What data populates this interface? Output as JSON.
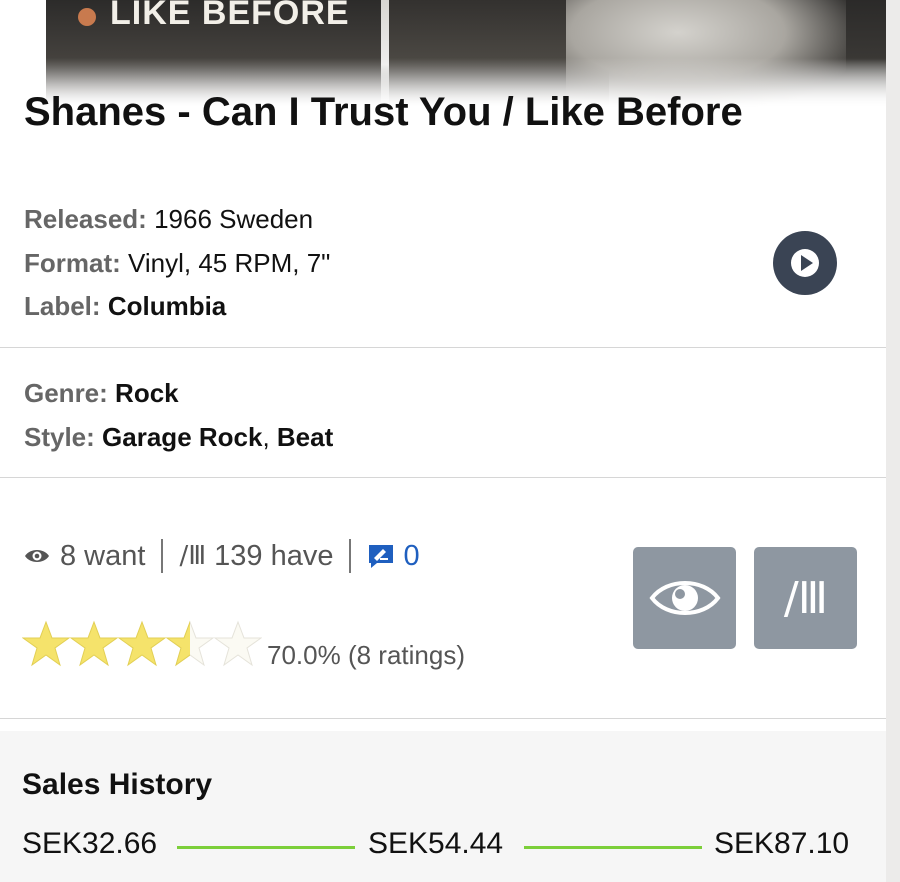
{
  "cover": {
    "visible_text": "LIKE BEFORE"
  },
  "release": {
    "title": "Shanes - Can I Trust You / Like Before",
    "released": {
      "label": "Released:",
      "value": "1966 Sweden"
    },
    "format": {
      "label": "Format:",
      "value": "Vinyl, 45 RPM, 7\""
    },
    "label": {
      "label": "Label:",
      "value": "Columbia"
    },
    "genre": {
      "label": "Genre:",
      "value": "Rock"
    },
    "style": {
      "label": "Style:",
      "values": [
        "Garage Rock",
        "Beat"
      ],
      "separator": ", "
    }
  },
  "stats": {
    "want": "8 want",
    "have_icon_text": "/Ⅲ",
    "have": "139 have",
    "comments": "0"
  },
  "rating": {
    "stars_filled": 3.5,
    "stars_total": 5,
    "text": "70.0% (8 ratings)"
  },
  "actions": {
    "want_button_icon": "eye-icon",
    "collection_button_text": "/Ⅲ"
  },
  "sales_history": {
    "title": "Sales History",
    "low": "SEK32.66",
    "median": "SEK54.44",
    "high": "SEK87.10"
  },
  "colors": {
    "accent_green": "#7ccf3a",
    "button_gray": "#8e97a1",
    "play_dark": "#3a4454",
    "star_yellow": "#f5e36b",
    "link_blue": "#1f5fbf"
  }
}
